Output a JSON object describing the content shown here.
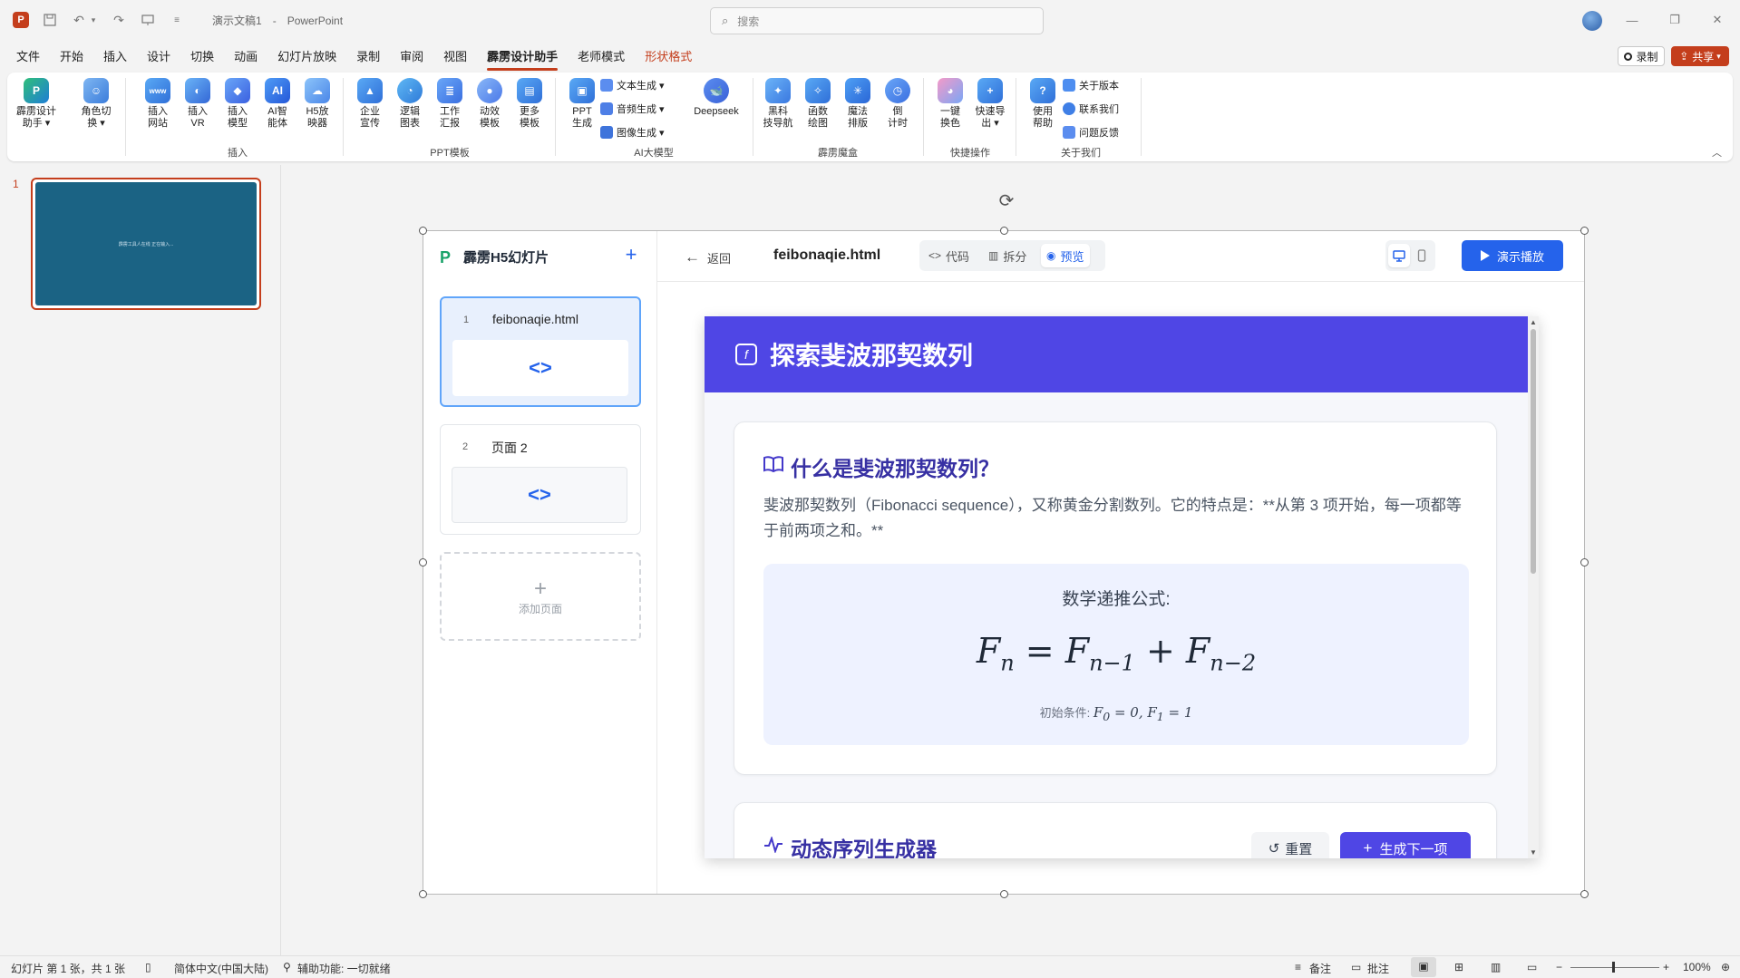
{
  "titlebar": {
    "doc_name": "演示文稿1",
    "separator": "-",
    "app_name": "PowerPoint",
    "search_placeholder": "搜索"
  },
  "menu": {
    "items": [
      "文件",
      "开始",
      "插入",
      "设计",
      "切换",
      "动画",
      "幻灯片放映",
      "录制",
      "审阅",
      "视图",
      "霹雳设计助手",
      "老师模式",
      "形状格式"
    ],
    "active": "霹雳设计助手",
    "record_label": "录制",
    "share_label": "共享"
  },
  "ribbon": {
    "buttons": {
      "designer": "霹雳设计\n助手 ▾",
      "role": "角色切\n换 ▾",
      "web": "插入\n网站",
      "vr": "插入\nVR",
      "model": "插入\n模型",
      "ai_agent": "AI智\n能体",
      "h5": "H5放\n映器",
      "enterprise": "企业\n宣传",
      "logic": "逻辑\n图表",
      "work": "工作\n汇报",
      "anim": "动效\n模板",
      "more": "更多\n模板",
      "ppt_gen": "PPT\n生成",
      "deepseek": "Deepseek",
      "nav": "黑科\n技导航",
      "func": "函数\n绘图",
      "magic": "魔法\n排版",
      "timer": "倒\n计时",
      "recolor": "一键\n换色",
      "export": "快速导\n出 ▾",
      "help": "使用\n帮助"
    },
    "small": {
      "text_gen": "文本生成 ▾",
      "audio_gen": "音频生成 ▾",
      "image_gen": "图像生成 ▾",
      "version": "关于版本",
      "contact": "联系我们",
      "feedback": "问题反馈"
    },
    "groups": {
      "insert": "插入",
      "ppt_tpl": "PPT模板",
      "ai": "AI大模型",
      "magic": "霹雳魔盒",
      "quick": "快捷操作",
      "about": "关于我们"
    }
  },
  "thumbnails": {
    "number": "1",
    "text": "霹雳工具人在线\n正在输入..."
  },
  "h5app": {
    "brand": "霹雳H5幻灯片",
    "pages": [
      {
        "num": "1",
        "title": "feibonaqie.html"
      },
      {
        "num": "2",
        "title": "页面 2"
      }
    ],
    "add_page": "添加页面",
    "back": "返回",
    "filename": "feibonaqie.html",
    "tabs": {
      "code": "代码",
      "split": "拆分",
      "preview": "预览"
    },
    "play": "演示播放"
  },
  "preview": {
    "header_title": "探索斐波那契数列",
    "card1": {
      "title": "什么是斐波那契数列？",
      "para": "斐波那契数列（Fibonacci sequence），又称黄金分割数列。它的特点是：**从第 3 项开始，每一项都等于前两项之和。**",
      "formula_label": "数学递推公式:",
      "initial_label": "初始条件:"
    },
    "card2": {
      "title": "动态序列生成器",
      "reset": "重置",
      "next": "生成下一项"
    }
  },
  "statusbar": {
    "slide_info": "幻灯片 第 1 张，共 1 张",
    "language": "简体中文(中国大陆)",
    "accessibility": "辅助功能: 一切就绪",
    "notes": "备注",
    "comments": "批注",
    "zoom": "100%"
  },
  "colors": {
    "accent": "#c43e1c",
    "indigo": "#4f46e5",
    "blue": "#2563eb",
    "thumb_bg": "#1b6384"
  }
}
